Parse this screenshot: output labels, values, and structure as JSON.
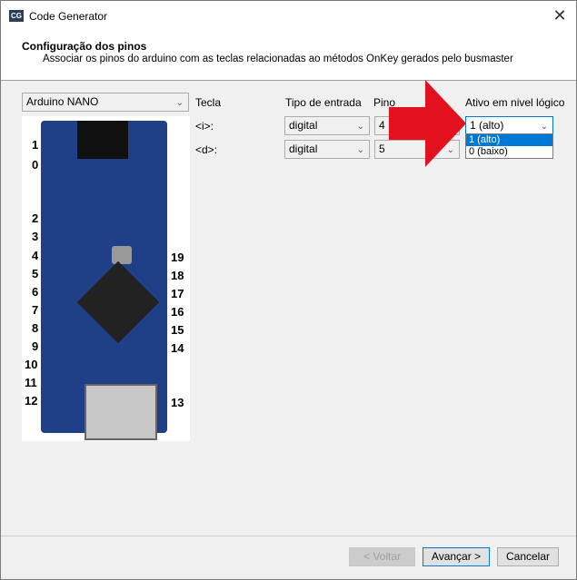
{
  "window": {
    "app_icon": "CG",
    "title": "Code Generator"
  },
  "header": {
    "title": "Configuração dos pinos",
    "subtitle": "Associar os pinos do arduino com as teclas relacionadas ao métodos OnKey gerados pelo busmaster"
  },
  "board_select": {
    "value": "Arduino NANO"
  },
  "columns": {
    "tecla": "Tecla",
    "tipo": "Tipo de entrada",
    "pino": "Pino",
    "ativo": "Ativo em nivel lógico"
  },
  "rows": [
    {
      "tecla": "<i>:",
      "tipo": "digital",
      "pino": "4",
      "ativo": "1 (alto)"
    },
    {
      "tecla": "<d>:",
      "tipo": "digital",
      "pino": "5",
      "ativo": ""
    }
  ],
  "dropdown_options": [
    "1 (alto)",
    "0 (baixo)"
  ],
  "board_labels": {
    "left": [
      "1",
      "0",
      "2",
      "3",
      "4",
      "5",
      "6",
      "7",
      "8",
      "9",
      "10",
      "11",
      "12"
    ],
    "right": [
      "19",
      "18",
      "17",
      "16",
      "15",
      "14",
      "13"
    ]
  },
  "buttons": {
    "back": "< Voltar",
    "next": "Avançar >",
    "cancel": "Cancelar"
  },
  "colors": {
    "arrow": "#e3101e",
    "accent": "#0078d7",
    "board": "#1f3f86"
  }
}
